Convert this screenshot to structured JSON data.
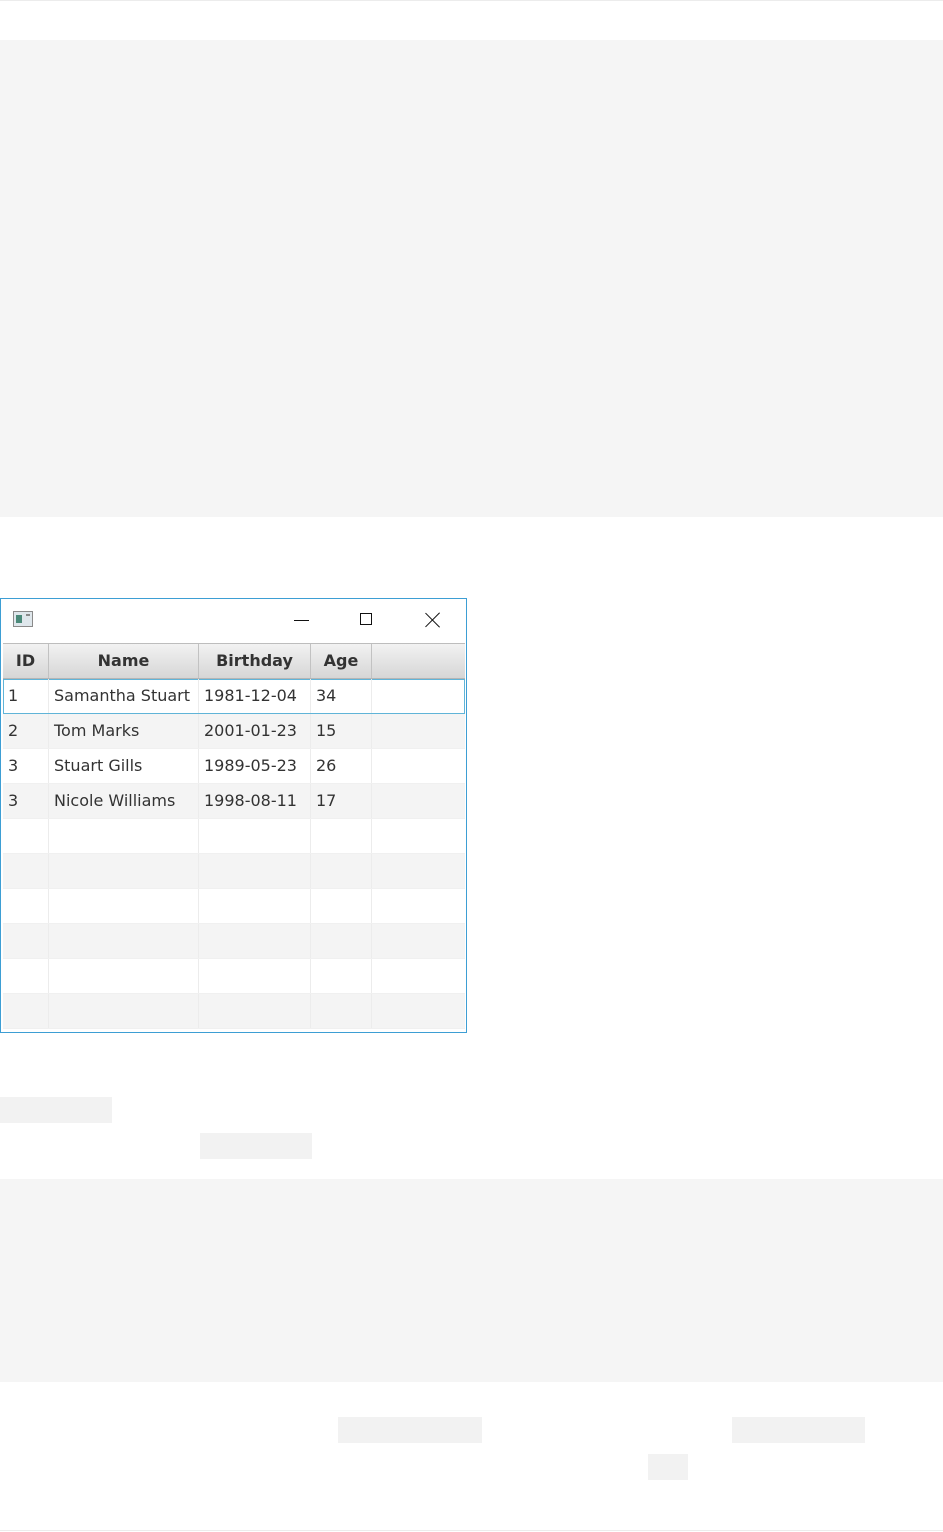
{
  "window": {
    "controls": {
      "minimize": "minimize",
      "maximize": "maximize",
      "close": "close"
    }
  },
  "table": {
    "columns": [
      "ID",
      "Name",
      "Birthday",
      "Age"
    ],
    "rows": [
      [
        "1",
        "Samantha Stuart",
        "1981-12-04",
        "34"
      ],
      [
        "2",
        "Tom Marks",
        "2001-01-23",
        "15"
      ],
      [
        "3",
        "Stuart Gills",
        "1989-05-23",
        "26"
      ],
      [
        "3",
        "Nicole Williams",
        "1998-08-11",
        "17"
      ]
    ],
    "empty_rows": 6,
    "selected_row": 0
  }
}
